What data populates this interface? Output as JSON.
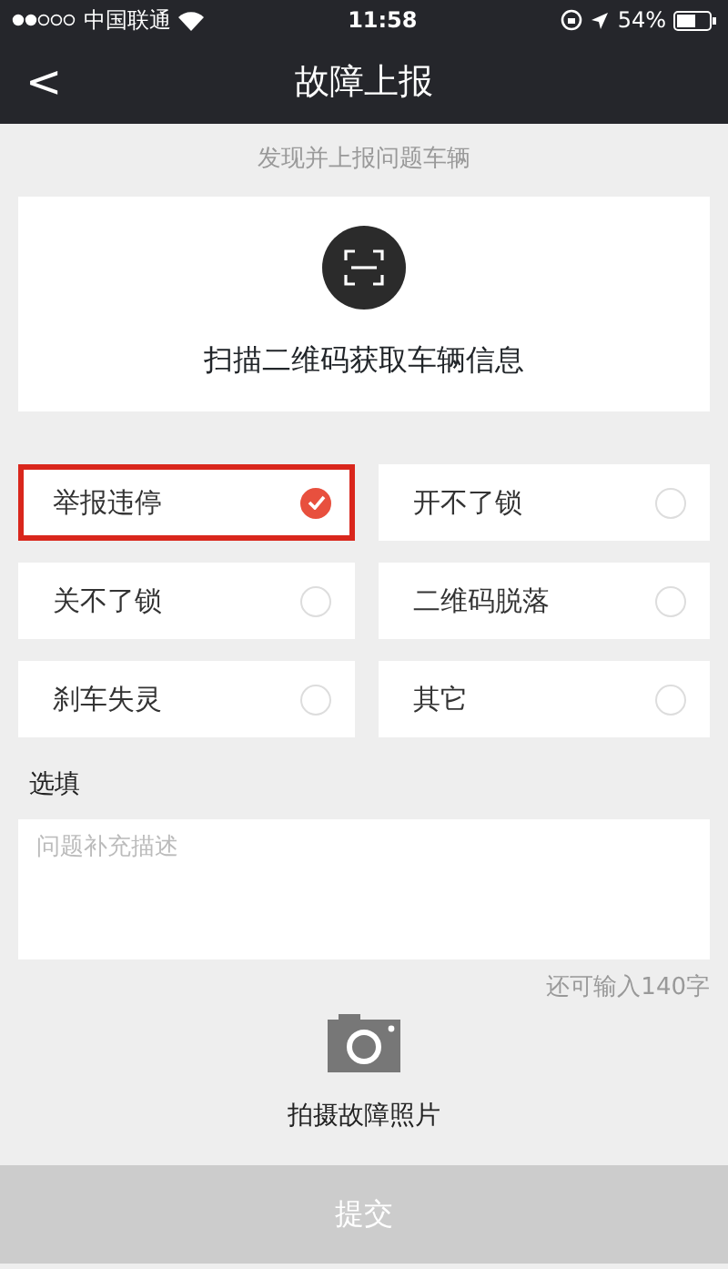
{
  "status_bar": {
    "carrier": "中国联通",
    "time": "11:58",
    "battery": "54%",
    "signal_dots": [
      {
        "filled": true
      },
      {
        "filled": true
      },
      {
        "filled": false
      },
      {
        "filled": false
      },
      {
        "filled": false
      }
    ]
  },
  "nav": {
    "back": "<",
    "title": "故障上报"
  },
  "subtitle": "发现并上报问题车辆",
  "scan": {
    "label": "扫描二维码获取车辆信息"
  },
  "options": [
    {
      "label": "举报违停",
      "selected": true,
      "highlighted": true
    },
    {
      "label": "开不了锁",
      "selected": false,
      "highlighted": false
    },
    {
      "label": "关不了锁",
      "selected": false,
      "highlighted": false
    },
    {
      "label": "二维码脱落",
      "selected": false,
      "highlighted": false
    },
    {
      "label": "刹车失灵",
      "selected": false,
      "highlighted": false
    },
    {
      "label": "其它",
      "selected": false,
      "highlighted": false
    }
  ],
  "optional_label": "选填",
  "description": {
    "placeholder": "问题补充描述"
  },
  "counter": "还可输入140字",
  "photo": {
    "label": "拍摄故障照片"
  },
  "submit": {
    "label": "提交",
    "disabled": true
  }
}
